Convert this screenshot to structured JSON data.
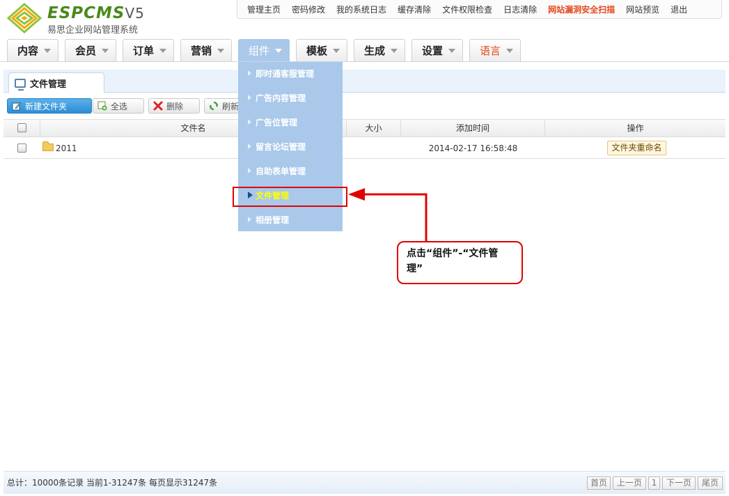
{
  "logo": {
    "brand": "ESPCMS",
    "version": "V5",
    "subtitle": "易思企业网站管理系统"
  },
  "topbar": {
    "links": [
      "管理主页",
      "密码修改",
      "我的系统日志",
      "缓存清除",
      "文件权限检查",
      "日志清除",
      "网站漏洞安全扫描",
      "网站预览",
      "退出"
    ]
  },
  "nav": {
    "tabs": [
      "内容",
      "会员",
      "订单",
      "营销",
      "组件",
      "模板",
      "生成",
      "设置",
      "语言"
    ],
    "active": "组件"
  },
  "dropdown": {
    "items": [
      "即时通客服管理",
      "广告内容管理",
      "广告位管理",
      "留言论坛管理",
      "自助表单管理",
      "文件管理",
      "相册管理"
    ],
    "selected": "文件管理"
  },
  "panel": {
    "tab_title": "文件管理"
  },
  "toolbar": {
    "new_folder": "新建文件夹",
    "select_all": "全选",
    "delete": "删除",
    "refresh": "刷新"
  },
  "table": {
    "headers": {
      "filename": "文件名",
      "size": "大小",
      "added": "添加时间",
      "action": "操作"
    },
    "rows": [
      {
        "name": "2011",
        "size": "",
        "added": "2014-02-17 16:58:48",
        "action": "文件夹重命名"
      }
    ]
  },
  "annotation": {
    "text": "点击“组件”-“文件管理”"
  },
  "footer": {
    "stats": "总计：10000条记录 当前1-31247条 每页显示31247条",
    "pager": [
      "首页",
      "上一页",
      "1",
      "下一页",
      "尾页"
    ]
  },
  "colors": {
    "accent": "#a9c8ea",
    "brand": "#4a8a1c",
    "warning": "#e4481c",
    "annotation": "#e00000"
  }
}
